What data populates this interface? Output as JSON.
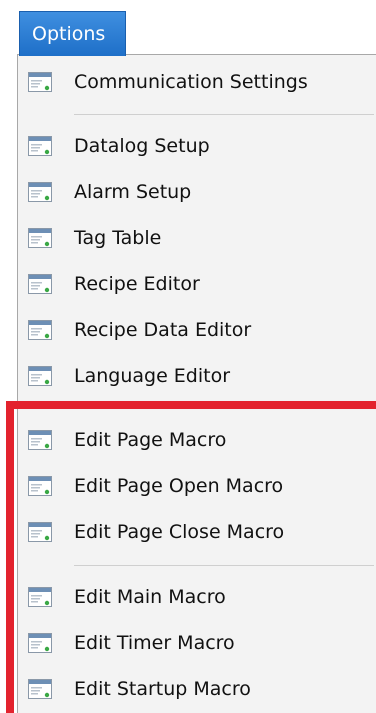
{
  "menu": {
    "title": "Options",
    "accent_color": "#1e6fc8",
    "highlight_color": "#e3232e",
    "icon": "window-form-icon",
    "items": [
      {
        "label": "Communication Settings"
      },
      {
        "label": "Datalog Setup"
      },
      {
        "label": "Alarm Setup"
      },
      {
        "label": "Tag Table"
      },
      {
        "label": "Recipe Editor"
      },
      {
        "label": "Recipe Data Editor"
      },
      {
        "label": "Language Editor"
      },
      {
        "label": "Edit Page Macro"
      },
      {
        "label": "Edit Page Open Macro"
      },
      {
        "label": "Edit Page Close Macro"
      },
      {
        "label": "Edit Main Macro"
      },
      {
        "label": "Edit Timer Macro"
      },
      {
        "label": "Edit Startup Macro"
      }
    ]
  }
}
